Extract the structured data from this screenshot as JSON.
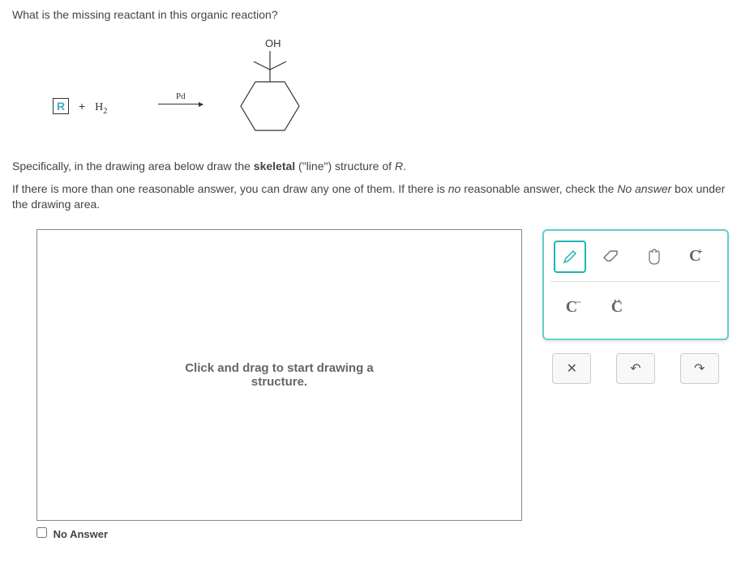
{
  "question": "What is the missing reactant in this organic reaction?",
  "reaction": {
    "reactant_placeholder": "R",
    "plus": "+",
    "h2": "H",
    "h2_sub": "2",
    "catalyst": "Pd",
    "product_label": "OH"
  },
  "instructions": {
    "line1_a": "Specifically, in the drawing area below draw the ",
    "line1_bold": "skeletal",
    "line1_b": " (\"line\") structure of ",
    "line1_r": "R",
    "line1_c": ".",
    "line2_a": "If there is more than one reasonable answer, you can draw any one of them. If there is ",
    "line2_no": "no",
    "line2_b": " reasonable answer, check the ",
    "line2_noans": "No answer",
    "line2_c": " box under the drawing area."
  },
  "drawing": {
    "placeholder_line1": "Click and drag to start drawing a",
    "placeholder_line2": "structure."
  },
  "tools": {
    "pencil": "✎",
    "eraser": "eraser",
    "hand": "✋",
    "c_plus": "C",
    "c_plus_sup": "+",
    "c_minus": "C",
    "c_minus_sup": "−",
    "c_lone": "C"
  },
  "actions": {
    "clear": "✕",
    "undo": "↶",
    "redo": "↷"
  },
  "no_answer_label": "No Answer"
}
